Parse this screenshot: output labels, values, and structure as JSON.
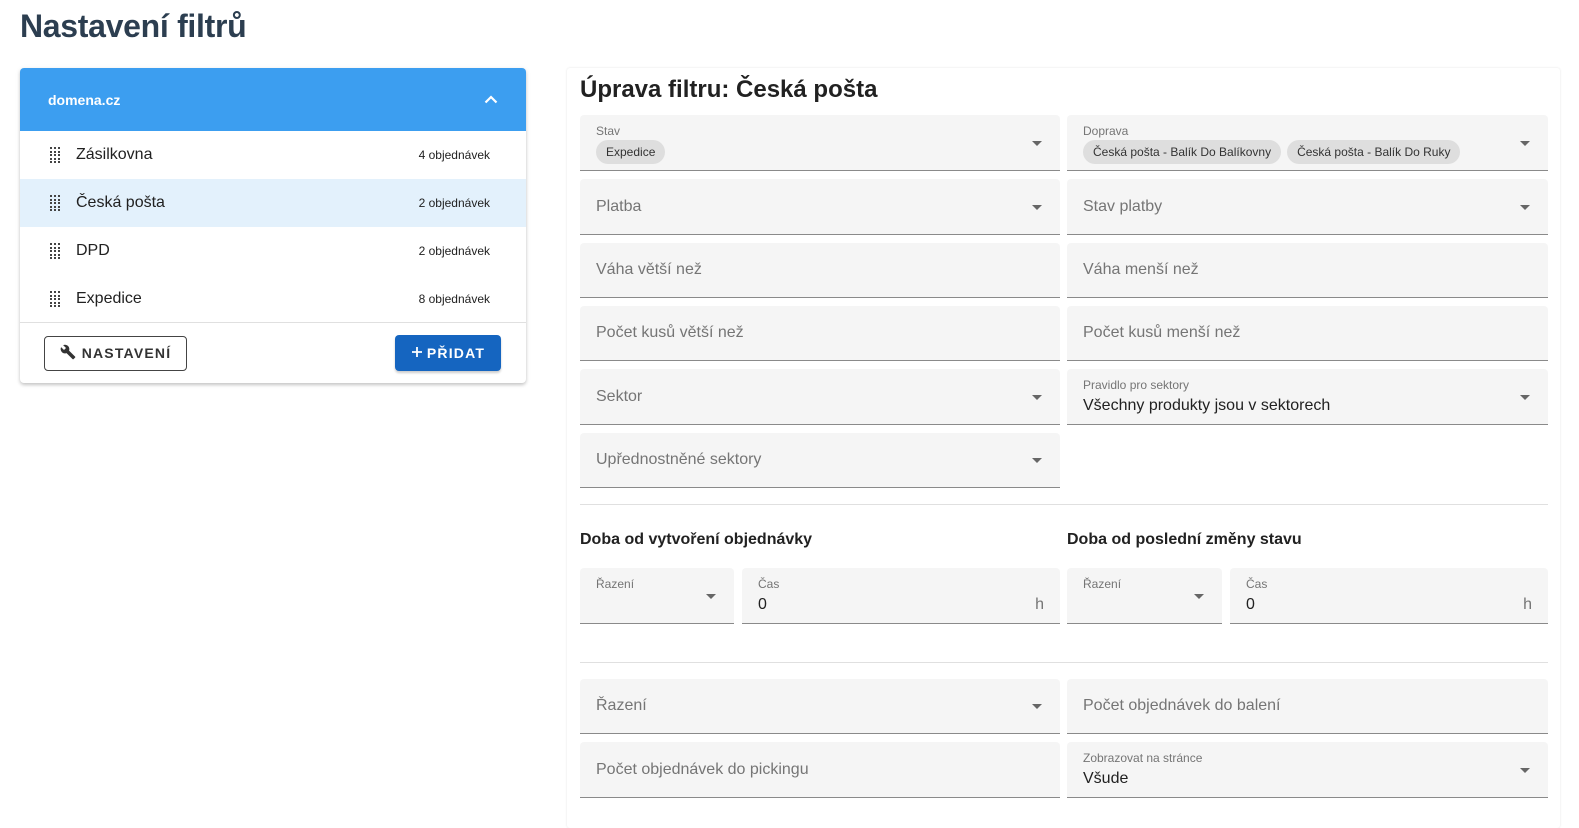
{
  "page_title": "Nastavení filtrů",
  "sidebar": {
    "domain": "domena.cz",
    "filters": [
      {
        "name": "Zásilkovna",
        "count": "4 objednávek",
        "active": false
      },
      {
        "name": "Česká pošta",
        "count": "2 objednávek",
        "active": true
      },
      {
        "name": "DPD",
        "count": "2 objednávek",
        "active": false
      },
      {
        "name": "Expedice",
        "count": "8 objednávek",
        "active": false
      }
    ],
    "settings_label": "NASTAVENÍ",
    "add_label": "PŘIDAT"
  },
  "editor": {
    "title": "Úprava filtru: Česká pošta",
    "stav": {
      "label": "Stav",
      "chips": [
        "Expedice"
      ]
    },
    "doprava": {
      "label": "Doprava",
      "chips": [
        "Česká pošta - Balík Do Balíkovny",
        "Česká pošta - Balík Do Ruky"
      ]
    },
    "platba": {
      "placeholder": "Platba"
    },
    "stav_platby": {
      "placeholder": "Stav platby"
    },
    "vaha_vetsi": {
      "placeholder": "Váha větší než"
    },
    "vaha_mensi": {
      "placeholder": "Váha menší než"
    },
    "kusy_vetsi": {
      "placeholder": "Počet kusů větší než"
    },
    "kusy_mensi": {
      "placeholder": "Počet kusů menší než"
    },
    "sektor": {
      "placeholder": "Sektor"
    },
    "pravidlo": {
      "label": "Pravidlo pro sektory",
      "value": "Všechny produkty jsou v sektorech"
    },
    "preferovane": {
      "placeholder": "Upřednostněné sektory"
    },
    "created_section": {
      "title": "Doba od vytvoření objednávky",
      "sort_label": "Řazení",
      "time_label": "Čas",
      "time_value": "0",
      "unit": "h"
    },
    "changed_section": {
      "title": "Doba od poslední změny stavu",
      "sort_label": "Řazení",
      "time_label": "Čas",
      "time_value": "0",
      "unit": "h"
    },
    "razeni": {
      "placeholder": "Řazení"
    },
    "pocet_baleni": {
      "placeholder": "Počet objednávek do balení"
    },
    "pocet_picking": {
      "placeholder": "Počet objednávek do pickingu"
    },
    "zobrazovat": {
      "label": "Zobrazovat na stránce",
      "value": "Všude"
    }
  }
}
